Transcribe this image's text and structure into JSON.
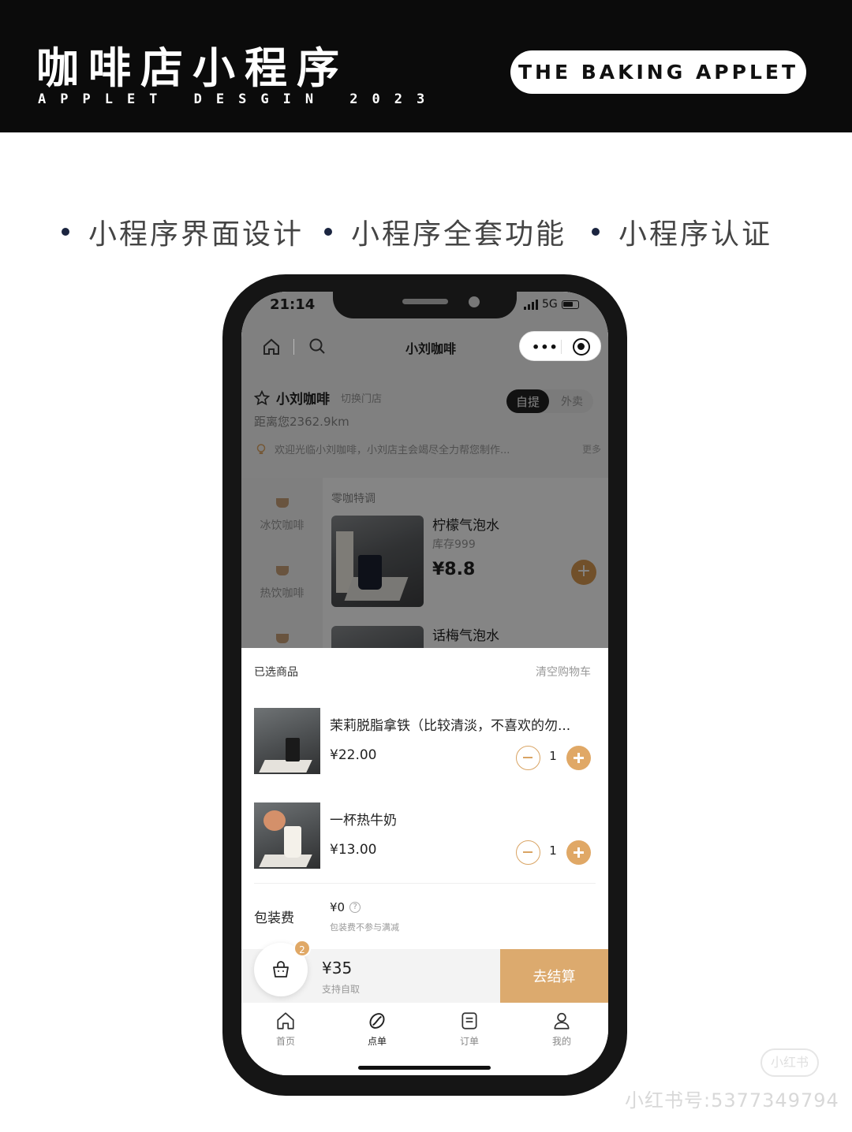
{
  "banner": {
    "title": "咖啡店小程序",
    "subtitle": "APPLET DESGIN 2023",
    "pill": "THE BAKING APPLET"
  },
  "features": [
    "小程序界面设计",
    "小程序全套功能",
    "小程序认证"
  ],
  "status_bar": {
    "time": "21:14",
    "network": "5G"
  },
  "nav": {
    "title": "小刘咖啡",
    "more": "•••"
  },
  "store": {
    "name": "小刘咖啡",
    "switch": "切换门店",
    "distance": "距离您2362.9km",
    "mode_pickup": "自提",
    "mode_delivery": "外卖",
    "notice": "欢迎光临小刘咖啡，小刘店主会竭尽全力帮您制作...",
    "notice_more": "更多"
  },
  "menu": {
    "categories": [
      "冰饮咖啡",
      "热饮咖啡"
    ],
    "section_title": "零咖特调",
    "products": [
      {
        "name": "柠檬气泡水",
        "stock": "库存999",
        "price": "¥8.8"
      },
      {
        "name": "话梅气泡水"
      }
    ],
    "add": "+"
  },
  "cart": {
    "header": "已选商品",
    "clear": "清空购物车",
    "items": [
      {
        "name": "茉莉脱脂拿铁（比较清淡，不喜欢的勿...",
        "price": "¥22.00",
        "qty": "1"
      },
      {
        "name": "一杯热牛奶",
        "price": "¥13.00",
        "qty": "1"
      }
    ],
    "packaging_label": "包装费",
    "packaging_price": "¥0",
    "packaging_help": "?",
    "packaging_note": "包装费不参与满减"
  },
  "checkout": {
    "badge": "2",
    "total": "¥35",
    "note": "支持自取",
    "button": "去结算"
  },
  "tabs": [
    {
      "label": "首页",
      "icon": "home-icon"
    },
    {
      "label": "点单",
      "icon": "coffee-bean-icon"
    },
    {
      "label": "订单",
      "icon": "order-list-icon"
    },
    {
      "label": "我的",
      "icon": "user-icon"
    }
  ],
  "watermark": {
    "logo": "小红书",
    "id": "小红书号:5377349794"
  }
}
